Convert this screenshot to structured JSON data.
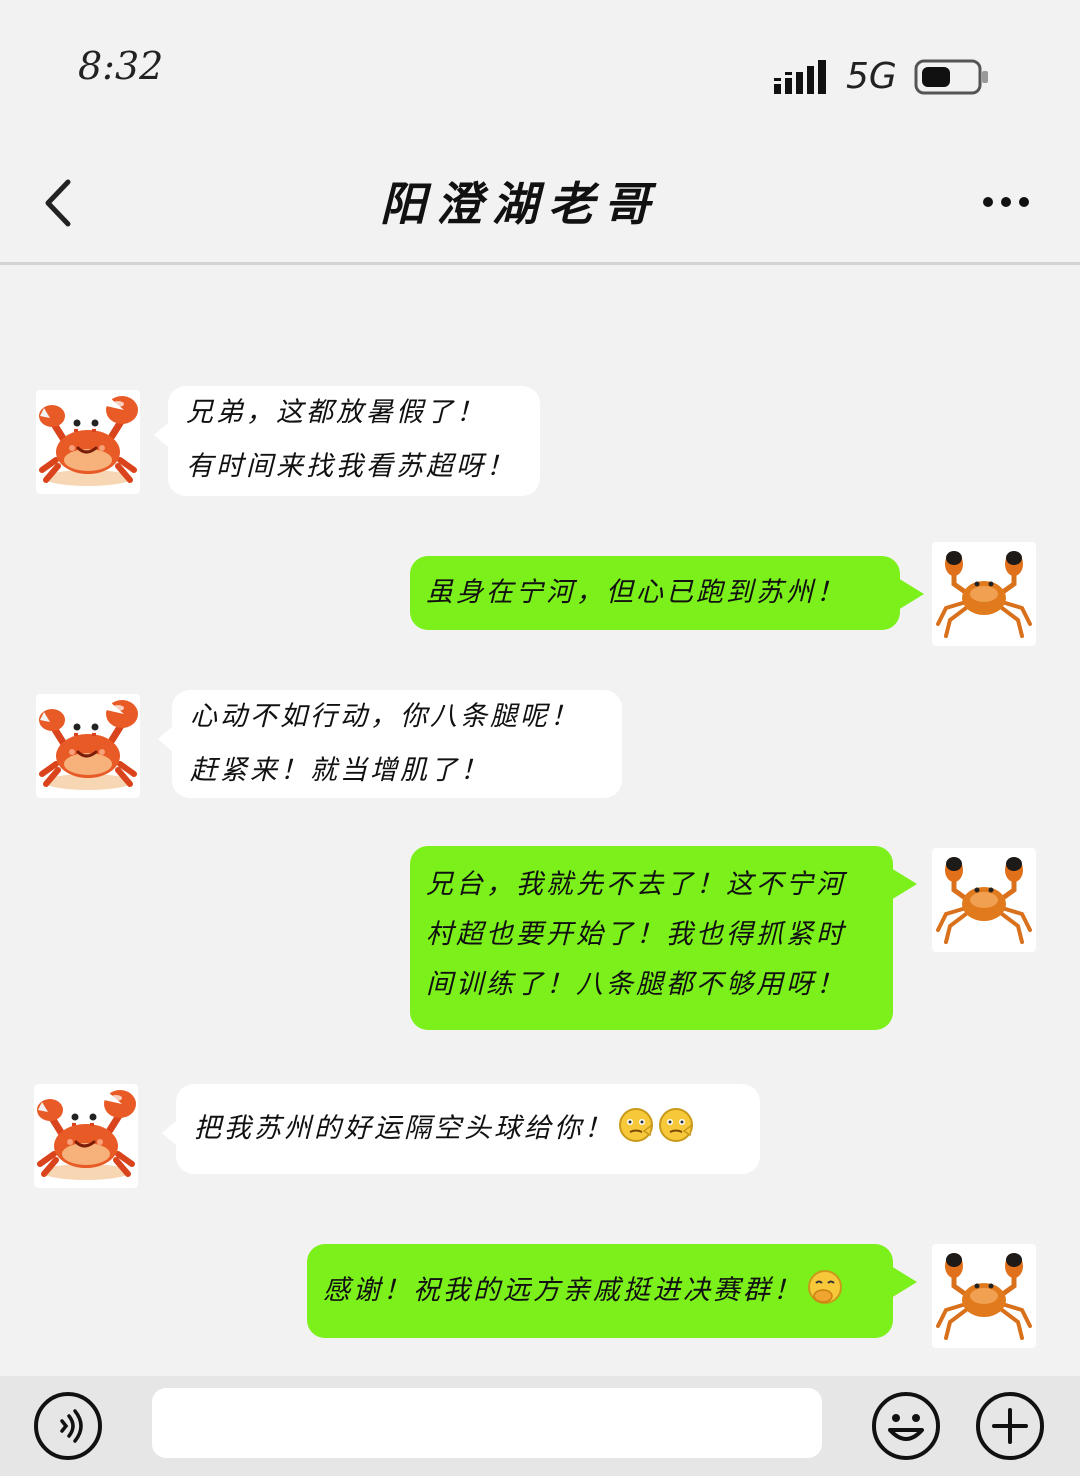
{
  "status_bar": {
    "time": "8:32",
    "network": "5G",
    "signal_icon": "signal-bars-icon",
    "battery_icon": "battery-icon"
  },
  "header": {
    "title": "阳澄湖老哥",
    "back_icon": "chevron-left-icon",
    "more_icon": "more-dots-icon"
  },
  "messages": [
    {
      "side": "received",
      "avatar": "cartoon-crab-avatar",
      "lines": [
        "兄弟，这都放暑假了！",
        "有时间来找我看苏超呀！"
      ]
    },
    {
      "side": "sent",
      "avatar": "hairy-crab-avatar",
      "lines": [
        "虽身在宁河，但心已跑到苏州！"
      ]
    },
    {
      "side": "received",
      "avatar": "cartoon-crab-avatar",
      "lines": [
        "心动不如行动，你八条腿呢！",
        "赶紧来！就当增肌了！"
      ]
    },
    {
      "side": "sent",
      "avatar": "hairy-crab-avatar",
      "lines": [
        "兄台，我就先不去了！这不宁河",
        "村超也要开始了！我也得抓紧时",
        "间训练了！八条腿都不够用呀！"
      ]
    },
    {
      "side": "received",
      "avatar": "cartoon-crab-avatar",
      "lines": [
        "把我苏州的好运隔空头球给你！"
      ],
      "emojis": [
        "pointing-emoji",
        "pointing-emoji"
      ]
    },
    {
      "side": "sent",
      "avatar": "hairy-crab-avatar",
      "lines": [
        "感谢！祝我的远方亲戚挺进决赛群！"
      ],
      "emojis": [
        "giggle-emoji"
      ]
    }
  ],
  "input_bar": {
    "voice_icon": "voice-icon",
    "input_placeholder": "",
    "emoji_icon": "smiley-icon",
    "add_icon": "plus-circle-icon"
  },
  "colors": {
    "background": "#f2f2f2",
    "sent_bubble": "#7bf01a",
    "received_bubble": "#ffffff",
    "input_bar": "#e6e6e6"
  }
}
